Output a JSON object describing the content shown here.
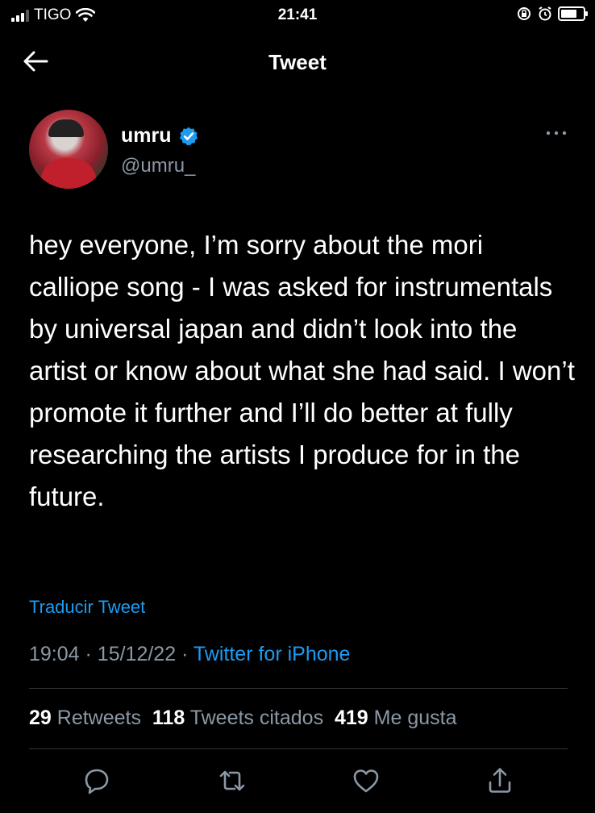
{
  "status_bar": {
    "carrier": "TIGO",
    "time": "21:41"
  },
  "nav": {
    "title": "Tweet"
  },
  "author": {
    "name": "umru",
    "handle": "@umru_",
    "verified": true
  },
  "tweet": {
    "text": "hey everyone, I’m sorry about the mori calliope song - I was asked for instrumentals by universal japan and didn’t look into the artist or know about what she had said. I won’t promote it further and I’ll do better at fully researching the artists I produce for in the future.",
    "translate_label": "Traducir Tweet",
    "time": "19:04",
    "date": "15/12/22",
    "separator": "·",
    "source": "Twitter for iPhone"
  },
  "stats": {
    "retweets_count": "29",
    "retweets_label": "Retweets",
    "quotes_count": "118",
    "quotes_label": "Tweets citados",
    "likes_count": "419",
    "likes_label": "Me gusta"
  },
  "colors": {
    "accent": "#1d9bf0",
    "background": "#000000",
    "secondary_text": "#8b98a5"
  },
  "icons": [
    "back-arrow-icon",
    "verified-badge-icon",
    "more-options-icon",
    "reply-icon",
    "retweet-icon",
    "like-icon",
    "share-icon"
  ]
}
